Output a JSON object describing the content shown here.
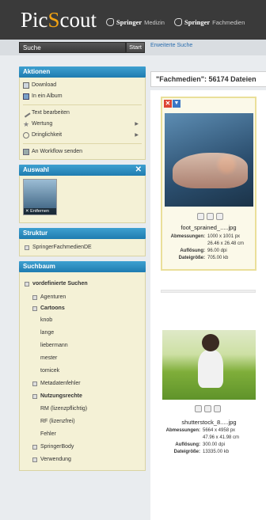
{
  "header": {
    "logo_pre": "Pic",
    "logo_o": "S",
    "logo_post": "cout",
    "brands": [
      {
        "bold": "Springer",
        "light": "Medizin"
      },
      {
        "bold": "Springer",
        "light": "Fachmedien"
      }
    ]
  },
  "search": {
    "placeholder": "Suche",
    "button_label": "Start",
    "advanced_link": "Erweiterte Suche"
  },
  "aktionen": {
    "title": "Aktionen",
    "items": [
      "Download",
      "In ein Album",
      "Text bearbeiten",
      "Wertung",
      "Dringlichkeit",
      "An Workflow senden"
    ]
  },
  "auswahl": {
    "title": "Auswahl",
    "close_symbol": "✕",
    "remove_label": "✕ Entfernen"
  },
  "struktur": {
    "title": "Struktur",
    "items": [
      "SpringerFachmedienDE"
    ]
  },
  "suchbaum": {
    "title": "Suchbaum",
    "items": [
      "vordefinierte Suchen",
      "Agenturen",
      "Cartoons",
      "knob",
      "lange",
      "liebermann",
      "mester",
      "tomicek",
      "Metadatenfehler",
      "Nutzungsrechte",
      "RM (lizenzpflichtig)",
      "RF (lizenzfrei)",
      "Fehler",
      "SpringerBody",
      "Verwendung"
    ]
  },
  "results": {
    "header": "\"Fachmedien\": 56174 Dateien"
  },
  "card1": {
    "filename": "foot_sprained_.....jpg",
    "meta": [
      {
        "k": "Abmessungen:",
        "v": "1000 x 1001 px"
      },
      {
        "k": "",
        "v": "26.46 x 26.48 cm"
      },
      {
        "k": "Auflösung:",
        "v": "96.00 dpi"
      },
      {
        "k": "Dateigröße:",
        "v": "705.00 kb"
      }
    ]
  },
  "card2": {
    "filename": "shutterstock_8.....jpg",
    "meta": [
      {
        "k": "Abmessungen:",
        "v": "5664 x 4958 px"
      },
      {
        "k": "",
        "v": "47.96 x 41.98 cm"
      },
      {
        "k": "Auflösung:",
        "v": "300.00 dpi"
      },
      {
        "k": "Dateigröße:",
        "v": "13335.00 kb"
      }
    ]
  },
  "colors": {
    "panel_head": "#1f7cb0",
    "panel_body": "#f4f1d6",
    "logo_accent": "#f2a312"
  }
}
